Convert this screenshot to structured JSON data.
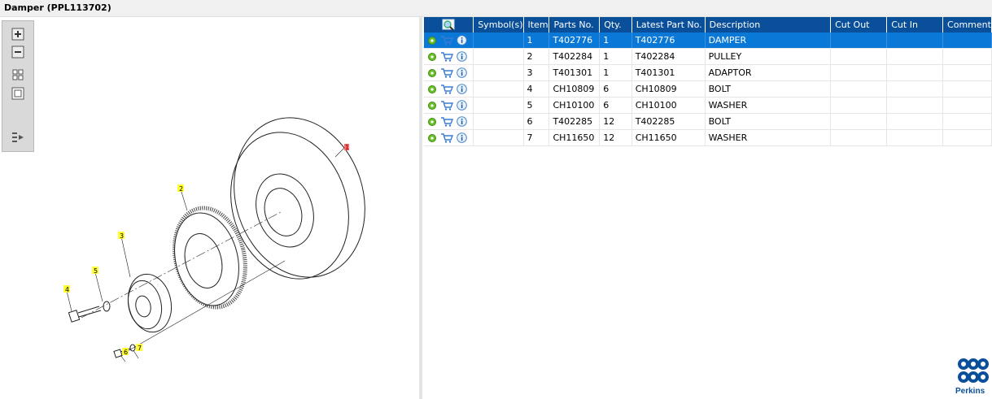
{
  "window": {
    "title": "Damper (PPL113702)"
  },
  "toolbox": {
    "tools": [
      {
        "name": "zoom-in-icon"
      },
      {
        "name": "zoom-out-icon"
      },
      {
        "name": "fit-all-icon"
      },
      {
        "name": "fit-window-icon"
      },
      {
        "name": "export-list-icon"
      }
    ]
  },
  "callouts": [
    "1",
    "2",
    "3",
    "4",
    "5",
    "6",
    "7"
  ],
  "table": {
    "columns": [
      "Symbol(s)",
      "Item",
      "Parts No.",
      "Qty.",
      "Latest Part No.",
      "Description",
      "Cut Out",
      "Cut In",
      "Comment"
    ],
    "rows": [
      {
        "item": "1",
        "part": "T402776",
        "qty": "1",
        "latest": "T402776",
        "desc": "DAMPER",
        "selected": true
      },
      {
        "item": "2",
        "part": "T402284",
        "qty": "1",
        "latest": "T402284",
        "desc": "PULLEY"
      },
      {
        "item": "3",
        "part": "T401301",
        "qty": "1",
        "latest": "T401301",
        "desc": "ADAPTOR"
      },
      {
        "item": "4",
        "part": "CH10809",
        "qty": "6",
        "latest": "CH10809",
        "desc": "BOLT"
      },
      {
        "item": "5",
        "part": "CH10100",
        "qty": "6",
        "latest": "CH10100",
        "desc": "WASHER"
      },
      {
        "item": "6",
        "part": "T402285",
        "qty": "12",
        "latest": "T402285",
        "desc": "BOLT"
      },
      {
        "item": "7",
        "part": "CH11650",
        "qty": "12",
        "latest": "CH11650",
        "desc": "WASHER"
      }
    ]
  },
  "brand": {
    "name": "Perkins",
    "color": "#0a4f9a"
  },
  "colors": {
    "header": "#0a4f9a",
    "selected_row": "#0a78d7",
    "callout": "#ffff33",
    "callout_selected": "#ff6666"
  }
}
